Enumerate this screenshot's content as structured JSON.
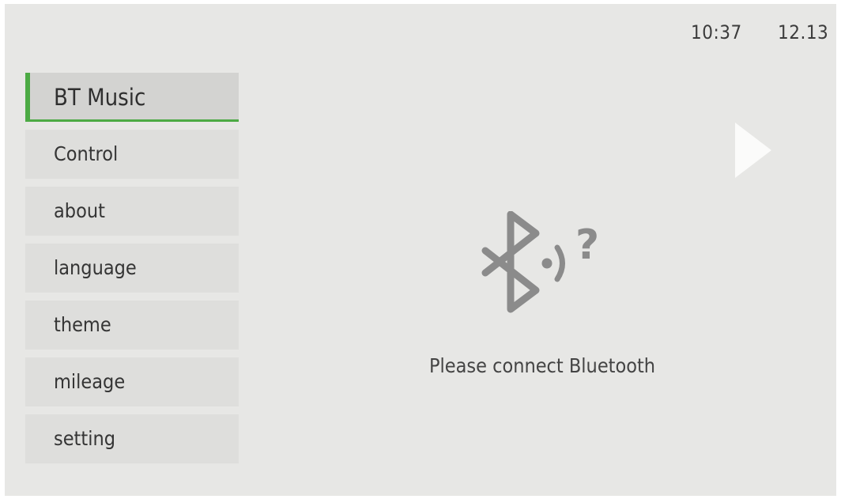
{
  "status": {
    "time": "10:37",
    "date": "12.13"
  },
  "menu": {
    "items": [
      {
        "label": "BT Music",
        "active": true
      },
      {
        "label": "Control"
      },
      {
        "label": "about"
      },
      {
        "label": "language"
      },
      {
        "label": "theme"
      },
      {
        "label": "mileage"
      },
      {
        "label": "setting"
      }
    ]
  },
  "main": {
    "icon": "bluetooth-searching-icon",
    "message": "Please connect Bluetooth",
    "next_icon": "play-arrow-icon"
  },
  "colors": {
    "accent": "#4caa44",
    "background": "#e7e7e5",
    "icon": "#8b8b8b"
  }
}
